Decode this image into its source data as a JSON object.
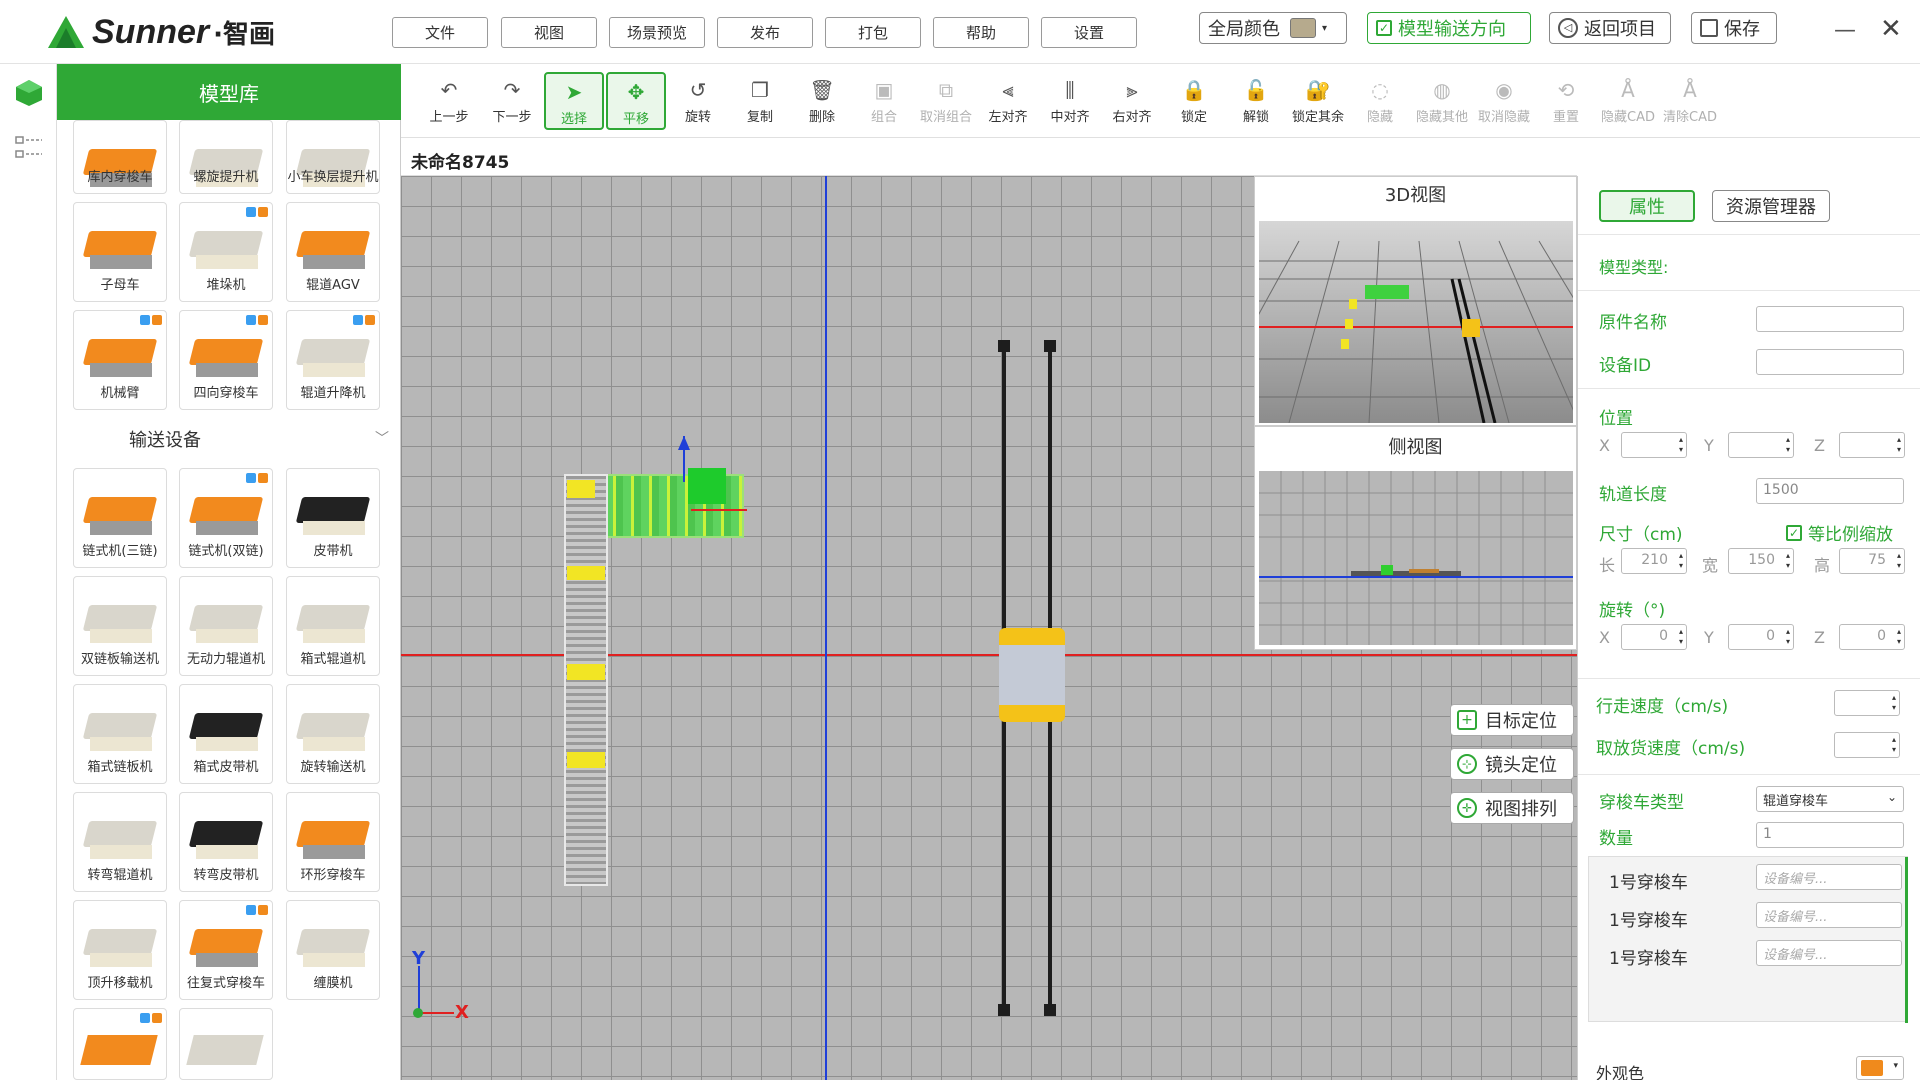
{
  "app": {
    "logo_text": "Sunner",
    "logo_cn": "·智画"
  },
  "menu": [
    "文件",
    "视图",
    "场景预览",
    "发布",
    "打包",
    "帮助",
    "设置"
  ],
  "top_controls": {
    "global_color_label": "全局颜色",
    "global_color": "#b6aa8d",
    "model_direction_label": "模型输送方向",
    "back_label": "返回项目",
    "save_label": "保存"
  },
  "library": {
    "title": "模型库",
    "row0": [
      "库内穿梭车",
      "螺旋提升机",
      "小车换层提升机"
    ],
    "row1": [
      "子母车",
      "堆垛机",
      "辊道AGV"
    ],
    "row2": [
      "机械臂",
      "四向穿梭车",
      "辊道升降机"
    ],
    "section_conveyor": "输送设备",
    "row3": [
      "链式机(三链)",
      "链式机(双链)",
      "皮带机"
    ],
    "row4": [
      "双链板输送机",
      "无动力辊道机",
      "箱式辊道机"
    ],
    "row5": [
      "箱式链板机",
      "箱式皮带机",
      "旋转输送机"
    ],
    "row6": [
      "转弯辊道机",
      "转弯皮带机",
      "环形穿梭车"
    ],
    "row7": [
      "顶升移载机",
      "往复式穿梭车",
      "缠膜机"
    ]
  },
  "toolbar": [
    {
      "label": "上一步",
      "icon": "undo-icon",
      "glyph": "↶"
    },
    {
      "label": "下一步",
      "icon": "redo-icon",
      "glyph": "↷"
    },
    {
      "label": "选择",
      "icon": "select-cursor-icon",
      "glyph": "➤"
    },
    {
      "label": "平移",
      "icon": "move-icon",
      "glyph": "✥"
    },
    {
      "label": "旋转",
      "icon": "rotate-icon",
      "glyph": "↺"
    },
    {
      "label": "复制",
      "icon": "copy-icon",
      "glyph": "❐"
    },
    {
      "label": "删除",
      "icon": "delete-icon",
      "glyph": "🗑"
    },
    {
      "label": "组合",
      "icon": "group-icon",
      "glyph": "▣"
    },
    {
      "label": "取消组合",
      "icon": "ungroup-icon",
      "glyph": "⧉"
    },
    {
      "label": "左对齐",
      "icon": "align-left-icon",
      "glyph": "⫷"
    },
    {
      "label": "中对齐",
      "icon": "align-center-icon",
      "glyph": "⫼"
    },
    {
      "label": "右对齐",
      "icon": "align-right-icon",
      "glyph": "⫸"
    },
    {
      "label": "锁定",
      "icon": "lock-icon",
      "glyph": "🔒"
    },
    {
      "label": "解锁",
      "icon": "unlock-icon",
      "glyph": "🔓"
    },
    {
      "label": "锁定其余",
      "icon": "lock-others-icon",
      "glyph": "🔐"
    },
    {
      "label": "隐藏",
      "icon": "hide-icon",
      "glyph": "◌"
    },
    {
      "label": "隐藏其他",
      "icon": "hide-others-icon",
      "glyph": "◍"
    },
    {
      "label": "取消隐藏",
      "icon": "unhide-icon",
      "glyph": "◉"
    },
    {
      "label": "重置",
      "icon": "reset-icon",
      "glyph": "⟲"
    },
    {
      "label": "隐藏CAD",
      "icon": "hide-cad-icon",
      "glyph": "Å"
    },
    {
      "label": "清除CAD",
      "icon": "clear-cad-icon",
      "glyph": "Å"
    }
  ],
  "file": {
    "name": "未命名8745"
  },
  "views": {
    "view3d": "3D视图",
    "side": "侧视图",
    "target": "目标定位",
    "camera": "镜头定位",
    "arrange": "视图排列"
  },
  "axes": {
    "y": "Y",
    "x": "X"
  },
  "props": {
    "tab_props": "属性",
    "tab_res": "资源管理器",
    "model_type": "模型类型:",
    "part_name": "原件名称",
    "device_id": "设备ID",
    "position": "位置",
    "x": "X",
    "y": "Y",
    "z": "Z",
    "track_length": "轨道长度",
    "track_length_val": "1500",
    "size": "尺寸（cm)",
    "proportional": "等比例缩放",
    "len": "长",
    "len_val": "210",
    "width": "宽",
    "width_val": "150",
    "height": "高",
    "height_val": "75",
    "rotation": "旋转（°)",
    "rx": "0",
    "ry": "0",
    "rz": "0",
    "travel_speed": "行走速度（cm/s)",
    "pick_speed": "取放货速度（cm/s)",
    "shuttle_type": "穿梭车类型",
    "shuttle_type_val": "辊道穿梭车",
    "qty": "数量",
    "qty_val": "1",
    "shuttles": [
      "1号穿梭车",
      "1号穿梭车",
      "1号穿梭车"
    ],
    "shuttle_placeholder": "设备编号...",
    "appearance": "外观色",
    "appearance_color": "#f08a1c"
  },
  "colors": {
    "accent": "#2fa836",
    "canvas": "#b7b7b7",
    "axis_red": "#e02020",
    "axis_blue": "#1f3fd8"
  }
}
